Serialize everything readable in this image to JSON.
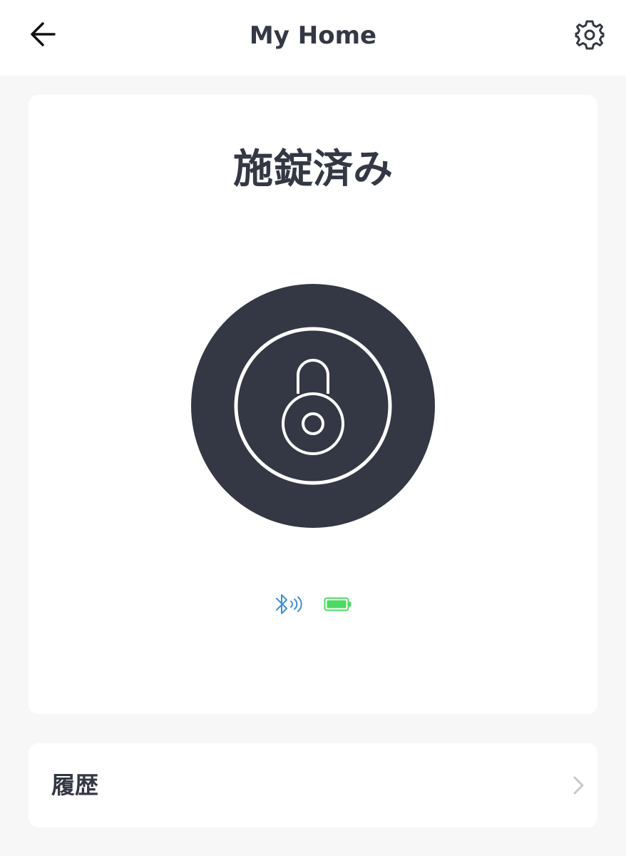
{
  "header": {
    "title": "My Home"
  },
  "lock": {
    "status": "施錠済み",
    "state": "locked"
  },
  "history": {
    "label": "履歴"
  },
  "colors": {
    "background": "#f7f7f7",
    "card": "#ffffff",
    "text": "#343844",
    "lock_circle": "#343844",
    "bluetooth": "#3c8fd6",
    "battery": "#4cd964",
    "chevron": "#c7c7cc"
  },
  "icons": {
    "back": "arrow-left-icon",
    "settings": "gear-icon",
    "lock": "padlock-icon",
    "bluetooth": "bluetooth-icon",
    "battery": "battery-full-icon",
    "chevron": "chevron-right-icon"
  }
}
